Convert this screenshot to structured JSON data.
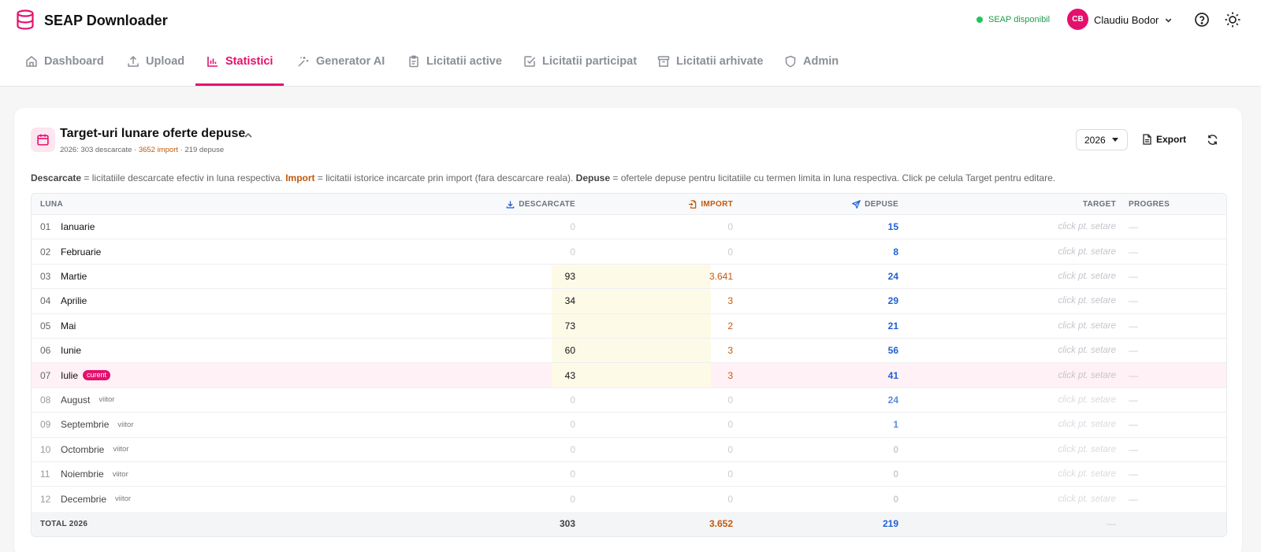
{
  "app": {
    "title": "SEAP Downloader"
  },
  "status": {
    "text": "SEAP disponibil",
    "color": "#22c55e"
  },
  "user": {
    "initials": "CB",
    "name": "Claudiu Bodor"
  },
  "accent": "#e5106e",
  "tabs": [
    {
      "label": "Dashboard",
      "icon": "home-icon"
    },
    {
      "label": "Upload",
      "icon": "upload-icon"
    },
    {
      "label": "Statistici",
      "icon": "bar-chart-icon",
      "active": true
    },
    {
      "label": "Generator AI",
      "icon": "sparkles-icon"
    },
    {
      "label": "Licitatii active",
      "icon": "clipboard-icon"
    },
    {
      "label": "Licitatii participat",
      "icon": "check-square-icon"
    },
    {
      "label": "Licitatii arhivate",
      "icon": "archive-icon"
    },
    {
      "label": "Admin",
      "icon": "shield-icon"
    }
  ],
  "card": {
    "title": "Target-uri lunare oferte depuse",
    "subtitle_a": "2026: 303 descarcate · ",
    "subtitle_imp": "3652 import",
    "subtitle_b": " · 219 depuse",
    "year": "2026",
    "export_label": "Export"
  },
  "legend": {
    "t1": "Descarcate",
    "t2": " = licitatiile descarcate efectiv in luna respectiva. ",
    "t3": "Import",
    "t4": " = licitatii istorice incarcate prin import (fara descarcare reala). ",
    "t5": "Depuse",
    "t6": " = ofertele depuse pentru licitatiile cu termen limita in luna respectiva. Click pe celula Target pentru editare."
  },
  "table": {
    "headers": {
      "luna": "LUNA",
      "descarcate": "DESCARCATE",
      "import": "IMPORT",
      "depuse": "DEPUSE",
      "target": "TARGET",
      "progres": "PROGRES"
    },
    "rows": [
      {
        "num": "01",
        "month": "Ianuarie",
        "tag": "",
        "desc": "0",
        "imp": "0",
        "dep": "15",
        "target": "click pt. setare",
        "progres": "—",
        "state": "past"
      },
      {
        "num": "02",
        "month": "Februarie",
        "tag": "",
        "desc": "0",
        "imp": "0",
        "dep": "8",
        "target": "click pt. setare",
        "progres": "—",
        "state": "past"
      },
      {
        "num": "03",
        "month": "Martie",
        "tag": "",
        "desc": "93",
        "imp": "3.641",
        "dep": "24",
        "target": "click pt. setare",
        "progres": "—",
        "state": "past"
      },
      {
        "num": "04",
        "month": "Aprilie",
        "tag": "",
        "desc": "34",
        "imp": "3",
        "dep": "29",
        "target": "click pt. setare",
        "progres": "—",
        "state": "past"
      },
      {
        "num": "05",
        "month": "Mai",
        "tag": "",
        "desc": "73",
        "imp": "2",
        "dep": "21",
        "target": "click pt. setare",
        "progres": "—",
        "state": "past"
      },
      {
        "num": "06",
        "month": "Iunie",
        "tag": "",
        "desc": "60",
        "imp": "3",
        "dep": "56",
        "target": "click pt. setare",
        "progres": "—",
        "state": "past"
      },
      {
        "num": "07",
        "month": "Iulie",
        "tag": "curent",
        "desc": "43",
        "imp": "3",
        "dep": "41",
        "target": "click pt. setare",
        "progres": "—",
        "state": "current"
      },
      {
        "num": "08",
        "month": "August",
        "tag": "viitor",
        "desc": "0",
        "imp": "0",
        "dep": "24",
        "target": "click pt. setare",
        "progres": "—",
        "state": "future"
      },
      {
        "num": "09",
        "month": "Septembrie",
        "tag": "viitor",
        "desc": "0",
        "imp": "0",
        "dep": "1",
        "target": "click pt. setare",
        "progres": "—",
        "state": "future"
      },
      {
        "num": "10",
        "month": "Octombrie",
        "tag": "viitor",
        "desc": "0",
        "imp": "0",
        "dep": "0",
        "target": "click pt. setare",
        "progres": "—",
        "state": "future"
      },
      {
        "num": "11",
        "month": "Noiembrie",
        "tag": "viitor",
        "desc": "0",
        "imp": "0",
        "dep": "0",
        "target": "click pt. setare",
        "progres": "—",
        "state": "future"
      },
      {
        "num": "12",
        "month": "Decembrie",
        "tag": "viitor",
        "desc": "0",
        "imp": "0",
        "dep": "0",
        "target": "click pt. setare",
        "progres": "—",
        "state": "future"
      }
    ],
    "total": {
      "label": "TOTAL 2026",
      "desc": "303",
      "imp": "3.652",
      "dep": "219",
      "target": "—"
    }
  }
}
